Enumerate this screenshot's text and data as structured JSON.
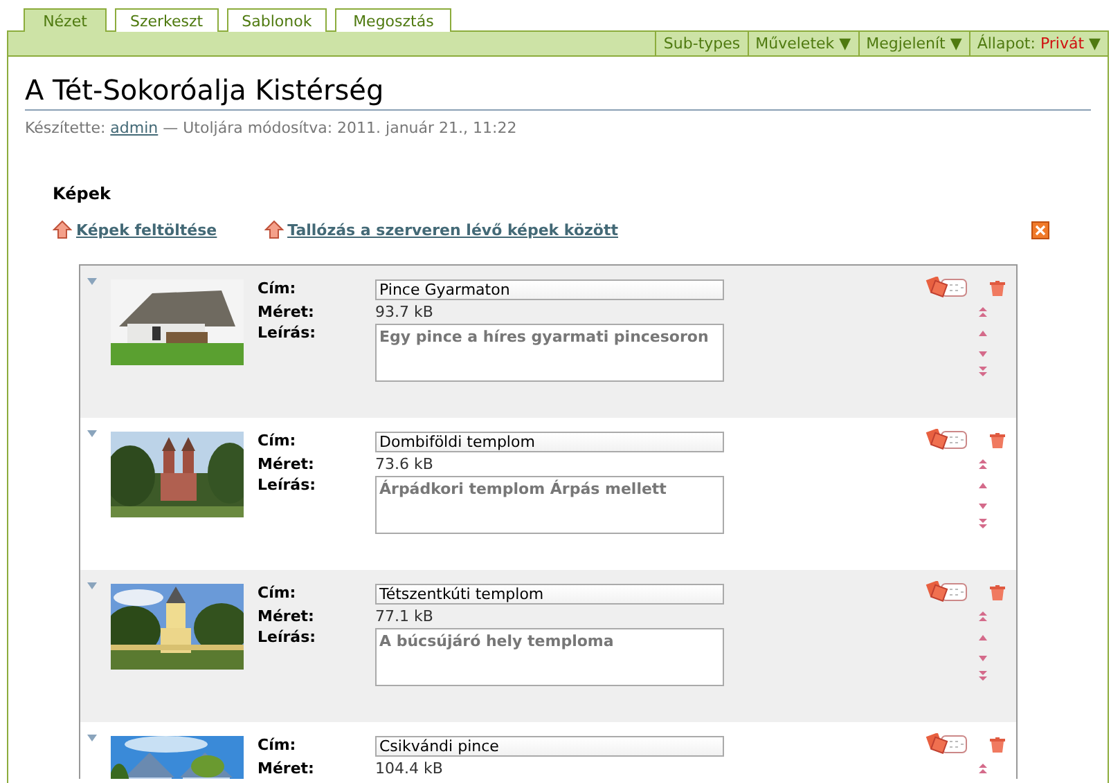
{
  "tabs": [
    {
      "label": "Nézet",
      "selected": true
    },
    {
      "label": "Szerkeszt",
      "selected": false
    },
    {
      "label": "Sablonok",
      "selected": false
    },
    {
      "label": "Megosztás",
      "selected": false
    }
  ],
  "menu": [
    {
      "label": "Sub-types"
    },
    {
      "label": "Műveletek",
      "caret": "▼"
    },
    {
      "label": "Megjelenít",
      "caret": "▼"
    },
    {
      "label": "Állapot:",
      "value": "Privát",
      "caret": "▼"
    }
  ],
  "title": "A Tét-Sokoróalja Kistérség",
  "byline": {
    "prefix": "Készítette:",
    "author": "admin",
    "suffix": "— Utoljára módosítva: 2011. január 21., 11:22"
  },
  "section_title": "Képek",
  "actions": [
    "Képek feltöltése",
    "Tallózás a szerveren lévő képek között"
  ],
  "images": [
    {
      "title_label": "Cím:",
      "title": "Pince Gyarmaton",
      "size_label": "Méret:",
      "size": "93.7 kB",
      "description_label": "Leírás:",
      "description": "Egy pince a híres gyarmati pincesoron"
    },
    {
      "title_label": "Cím:",
      "title": "Dombiföldi templom",
      "size_label": "Méret:",
      "size": "73.6 kB",
      "description_label": "Leírás:",
      "description": "Árpádkori templom Árpás mellett"
    },
    {
      "title_label": "Cím:",
      "title": "Tétszentkúti templom",
      "size_label": "Méret:",
      "size": "77.1 kB",
      "description_label": "Leírás:",
      "description": "A búcsújáró hely temploma"
    },
    {
      "title_label": "Cím:",
      "title": "Csikvándi pince",
      "size_label": "Méret:",
      "size": "104.4 kB"
    }
  ]
}
